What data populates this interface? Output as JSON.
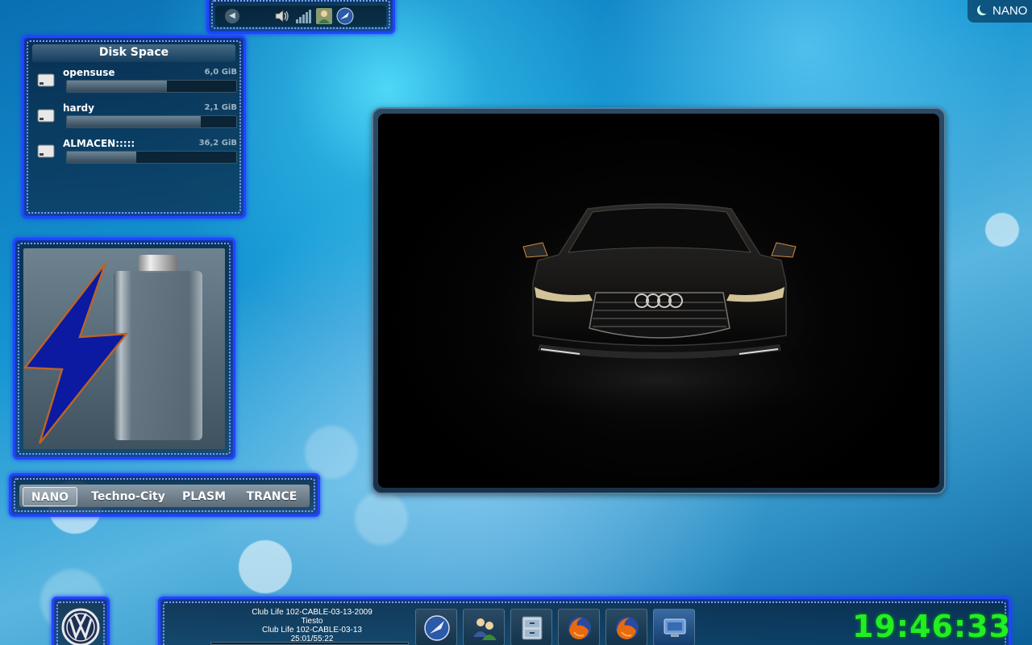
{
  "activity_indicator": {
    "label": "NANO"
  },
  "systray": {
    "icons": [
      "back-arrow-icon",
      "volume-icon",
      "network-signal-icon",
      "user-icon",
      "network-manager-icon"
    ]
  },
  "disk_space": {
    "title": "Disk Space",
    "disks": [
      {
        "name": "opensuse",
        "size": "6,0 GiB",
        "usage_fraction": 0.59
      },
      {
        "name": "hardy",
        "size": "2,1 GiB",
        "usage_fraction": 0.79
      },
      {
        "name": "ALMACEN:::::",
        "size": "36,2 GiB",
        "usage_fraction": 0.41
      }
    ]
  },
  "activities": [
    {
      "label": "NANO",
      "active": true
    },
    {
      "label": "Techno-City",
      "active": false
    },
    {
      "label": "PLASM",
      "active": false
    },
    {
      "label": "TRANCE",
      "active": false
    }
  ],
  "now_playing": {
    "line1": "Club Life 102-CABLE-03-13-2009",
    "artist": "Tiesto",
    "line3": "Club Life 102-CABLE-03-13",
    "time": "25:01/55:22",
    "progress_fraction": 0.45
  },
  "taskbar": {
    "items": [
      {
        "name": "konqueror-icon"
      },
      {
        "name": "contacts-icon"
      },
      {
        "name": "file-cabinet-icon"
      },
      {
        "name": "firefox-icon"
      },
      {
        "name": "firefox-icon"
      },
      {
        "name": "desktop-icon",
        "active": true
      }
    ]
  },
  "clock": {
    "time": "19:46:33",
    "color": "#22ee22"
  },
  "colors": {
    "neon_frame": "#2244ff",
    "clock": "#22ee22"
  }
}
